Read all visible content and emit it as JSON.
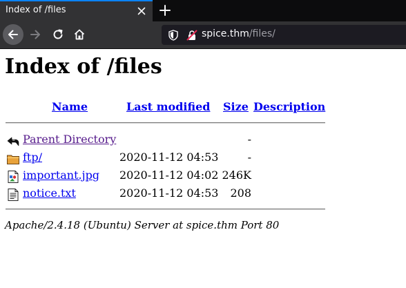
{
  "browser": {
    "tab_title": "Index of /files",
    "url_host": "spice.thm",
    "url_path": "/files/",
    "colors": {
      "accent": "#0a84ff",
      "toolbar": "#323234",
      "tabstrip": "#0c0c0d"
    }
  },
  "page": {
    "heading": "Index of /files",
    "columns": {
      "name": "Name",
      "last_modified": "Last modified",
      "size": "Size",
      "description": "Description"
    },
    "rows": [
      {
        "name": "Parent Directory",
        "date": "",
        "size": "-",
        "icon": "back-icon"
      },
      {
        "name": "ftp/",
        "date": "2020-11-12 04:53",
        "size": "-",
        "icon": "folder-icon"
      },
      {
        "name": "important.jpg",
        "date": "2020-11-12 04:02",
        "size": "246K",
        "icon": "image-icon"
      },
      {
        "name": "notice.txt",
        "date": "2020-11-12 04:53",
        "size": "208",
        "icon": "text-file-icon"
      }
    ],
    "footer": "Apache/2.4.18 (Ubuntu) Server at spice.thm Port 80",
    "colors": {
      "link": "#0000ee",
      "visited_link": "#551a8b"
    }
  }
}
